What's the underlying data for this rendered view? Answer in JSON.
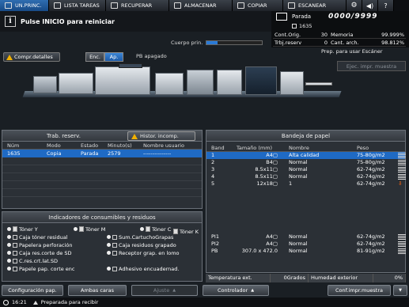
{
  "tabs": [
    {
      "label": "UN.PRINC.",
      "icon": "home-icon",
      "active": true
    },
    {
      "label": "LISTA TAREAS",
      "icon": "list-icon"
    },
    {
      "label": "RECUPERAR",
      "icon": "recall-icon"
    },
    {
      "label": "ALMACENAR",
      "icon": "store-icon"
    },
    {
      "label": "COPIAR",
      "icon": "copy-icon"
    },
    {
      "label": "ESCANEAR",
      "icon": "scan-icon"
    }
  ],
  "message": "Pulse INICIO para reiniciar",
  "toner_label": "Cuerpo prin.",
  "toner_level": 0.2,
  "status": {
    "label": "Parada",
    "count": "0000/9999",
    "jobs": "1635",
    "cont_orig_label": "Cont.Orig.",
    "cont_orig_value": "30",
    "memoria_label": "Memoria",
    "memoria_value": "99.999%",
    "trbj_reserv_label": "Trbj.reserv",
    "trbj_reserv_value": "0",
    "cant_arch_label": "Cant. arch.",
    "cant_arch_value": "98.812%"
  },
  "toolbar": {
    "compr_detalles": "Compr.detalles",
    "enc": "Enc.",
    "ap": "Ap.",
    "pb_apagado": "PB apagado",
    "prep_escaner": "Prep. para usar Escáner",
    "ejec_muestra": "Ejec. impr. muestra"
  },
  "reserv": {
    "title": "Trab. reserv.",
    "hist_btn": "Histor. incomp.",
    "columns": [
      "Núm",
      "Modo",
      "Estado",
      "Minuto(s)",
      "Nombre usuario"
    ],
    "rows": [
      [
        "1635",
        "Copia",
        "Parada",
        "2579",
        "---------------"
      ]
    ]
  },
  "indicators": {
    "title": "Indicadores de consumibles y residuos",
    "toners": [
      "Tóner Y",
      "Tóner M",
      "Tóner C",
      "Tóner K"
    ],
    "row2": [
      "Caja tóner residual",
      "Sum.CartuchoGrapas"
    ],
    "row3": [
      "Papelera perforación",
      "Caja residuos grapado"
    ],
    "row4": [
      "Caja res.corte de SD",
      "Receptor grap. en lomo"
    ],
    "row5": [
      "C.res.crt.lat.SD"
    ],
    "row6": [
      "Papele pap. corte enc",
      "Adhesivo encuadernad."
    ]
  },
  "paper": {
    "title": "Bandeja de papel",
    "columns": [
      "Band",
      "Tamaño (mm)",
      "Nombre",
      "Peso"
    ],
    "rows": [
      {
        "band": "1",
        "size": "A4▢",
        "name": "Alta calidad",
        "weight": "75-80g/m2",
        "sel": true,
        "ind": "bars"
      },
      {
        "band": "2",
        "size": "B4▢",
        "name": "Normal",
        "weight": "75-80g/m2",
        "ind": "bars"
      },
      {
        "band": "3",
        "size": "8.5x11▢",
        "name": "Normal",
        "weight": "62-74g/m2",
        "ind": "bars"
      },
      {
        "band": "4",
        "size": "8.5x11▢",
        "name": "Normal",
        "weight": "62-74g/m2",
        "ind": "bars"
      },
      {
        "band": "5",
        "size": "12x18▢",
        "name": "1",
        "weight": "62-74g/m2",
        "ind": "warn"
      }
    ],
    "rows_bottom": [
      {
        "band": "PI1",
        "size": "A4▢",
        "name": "Normal",
        "weight": "62-74g/m2",
        "ind": "bars"
      },
      {
        "band": "PI2",
        "size": "A4▢",
        "name": "Normal",
        "weight": "62-74g/m2",
        "ind": "bars"
      },
      {
        "band": "PB",
        "size": "307.0 x 472.0",
        "name": "Normal",
        "weight": "81-91g/m2",
        "ind": "bars"
      }
    ],
    "temp_label": "Temperatura ext.",
    "temp_value": "0Grados",
    "hum_label": "Humedad exterior",
    "hum_value": "0%"
  },
  "bottom": {
    "config_pap": "Configuración pap.",
    "ambas_caras": "Ambas caras",
    "ajuste": "Ajuste",
    "controlador": "Controlador",
    "conf_impr_muestra": "Conf.impr.muestra",
    "time": "16:21",
    "status_msg": "Preparada para recibir"
  }
}
